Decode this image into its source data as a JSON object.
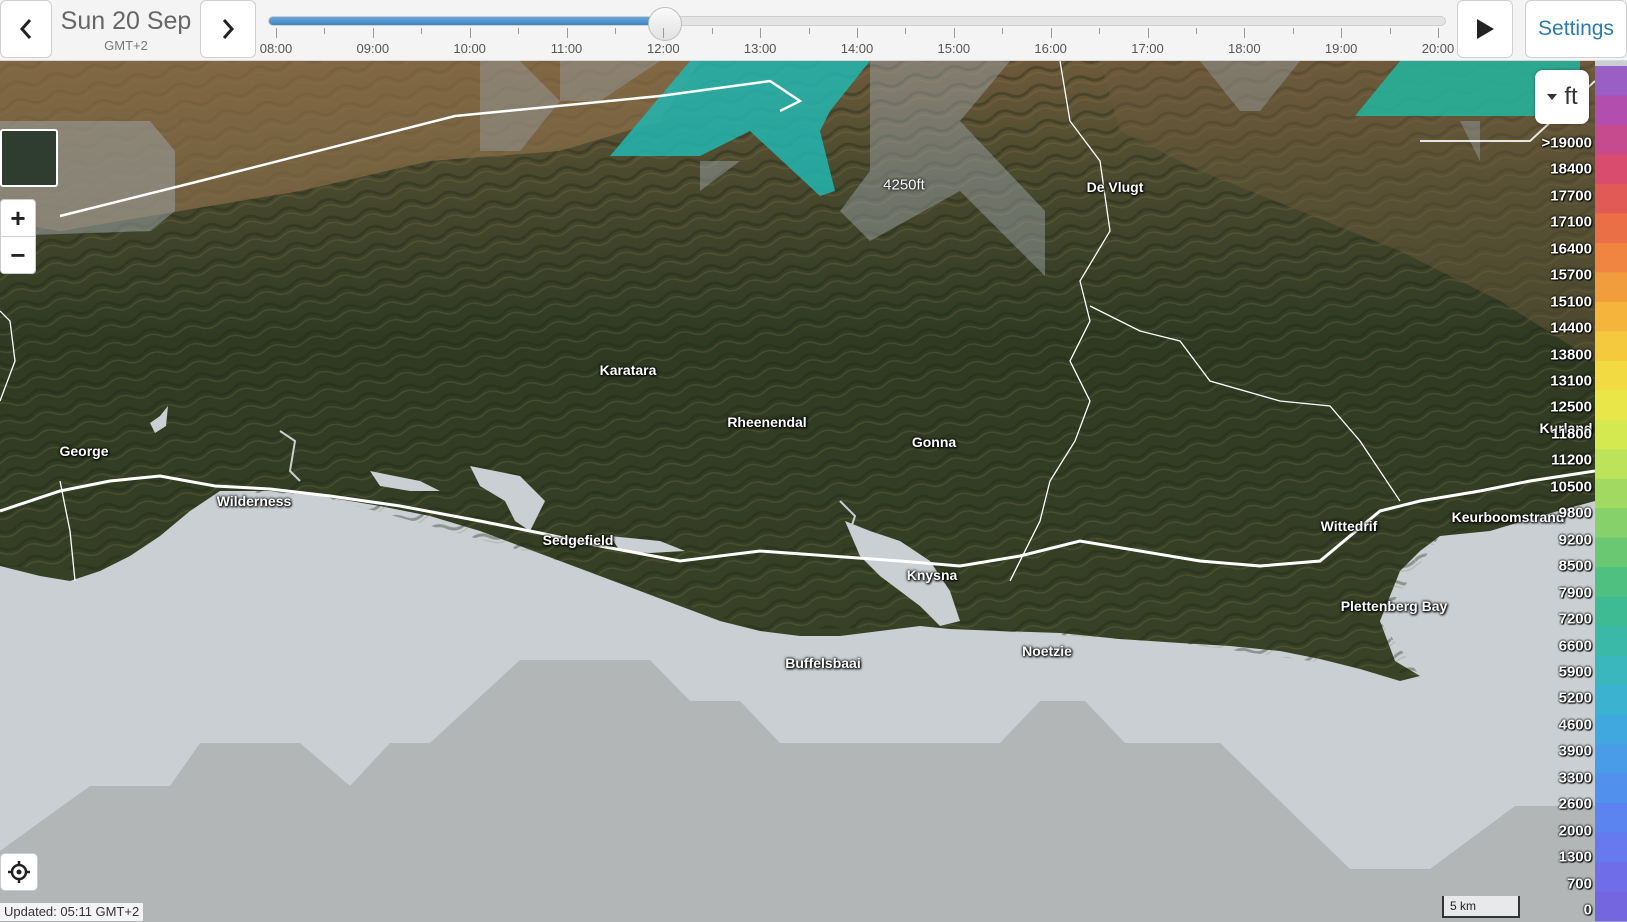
{
  "header": {
    "date": "Sun 20 Sep",
    "timezone": "GMT+2",
    "settings_label": "Settings",
    "prev_icon": "chevron-left-icon",
    "next_icon": "chevron-right-icon",
    "play_icon": "play-icon"
  },
  "timeline": {
    "labels": [
      "08:00",
      "09:00",
      "10:00",
      "11:00",
      "12:00",
      "13:00",
      "14:00",
      "15:00",
      "16:00",
      "17:00",
      "18:00",
      "19:00",
      "20:00"
    ],
    "position_fraction": 0.337,
    "selected": "12:00"
  },
  "map": {
    "places": [
      {
        "name": "De Vlugt"
      },
      {
        "name": "Karatara"
      },
      {
        "name": "Rheenendal"
      },
      {
        "name": "Gonna"
      },
      {
        "name": "George"
      },
      {
        "name": "Wilderness"
      },
      {
        "name": "Sedgefield"
      },
      {
        "name": "Knysna"
      },
      {
        "name": "Buffelsbaai"
      },
      {
        "name": "Noetzie"
      },
      {
        "name": "Wittedrif"
      },
      {
        "name": "Keurboomstrand"
      },
      {
        "name": "Plettenberg Bay"
      },
      {
        "name": "Kurland"
      }
    ],
    "altitude_label": "4250ft",
    "updated": "Updated: 05:11 GMT+2",
    "scale": "5 km",
    "zoom_in": "+",
    "zoom_out": "−",
    "unit": "ft"
  },
  "legend": {
    "labels": [
      ">19000",
      "18400",
      "17700",
      "17100",
      "16400",
      "15700",
      "15100",
      "14400",
      "13800",
      "13100",
      "12500",
      "11800",
      "11200",
      "10500",
      "9800",
      "9200",
      "8500",
      "7900",
      "7200",
      "6600",
      "5900",
      "5200",
      "4600",
      "3900",
      "3300",
      "2600",
      "2000",
      "1300",
      "700",
      "0"
    ],
    "colors": [
      "#9a5fc4",
      "#b24fae",
      "#c64a8e",
      "#d94c6e",
      "#e25a55",
      "#ea6e46",
      "#ef8540",
      "#f29d3d",
      "#f5b43c",
      "#f5c93e",
      "#f2db42",
      "#e9e64a",
      "#d4e84f",
      "#bde35a",
      "#a2da61",
      "#86d169",
      "#6ac873",
      "#50c081",
      "#3fbb93",
      "#3ab9a8",
      "#3ab7bd",
      "#3bb2d0",
      "#40a8df",
      "#489ce8",
      "#5290ee",
      "#5c84f0",
      "#6779ee",
      "#6f6ee8",
      "#7466de"
    ]
  }
}
